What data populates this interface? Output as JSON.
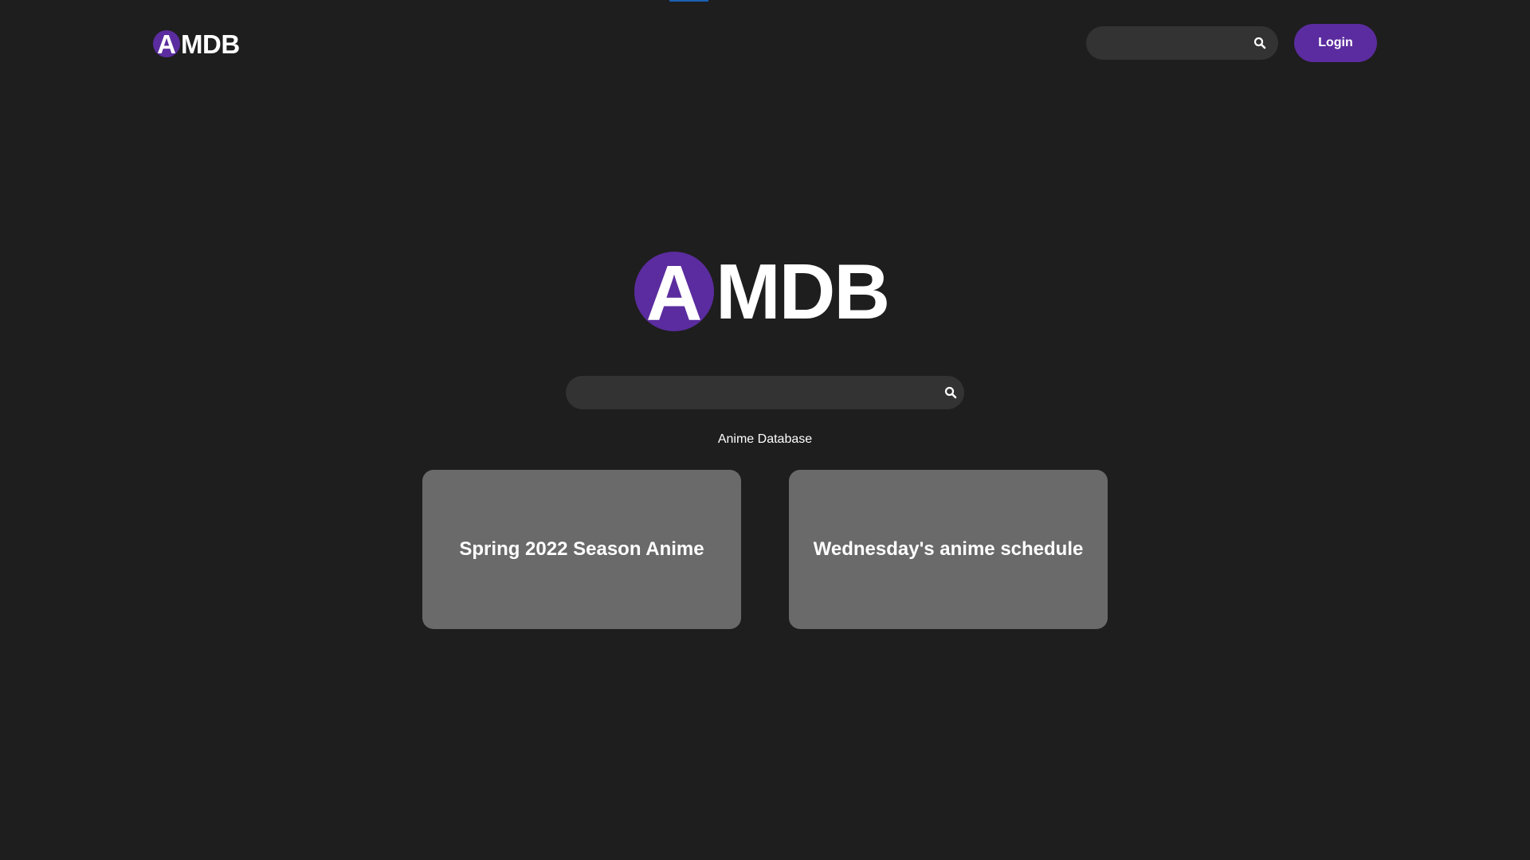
{
  "header": {
    "logo": {
      "letter": "A",
      "rest": "MDB"
    },
    "search": {
      "placeholder": "",
      "value": "",
      "icon": "search-icon"
    },
    "login_label": "Login"
  },
  "hero": {
    "logo": {
      "letter": "A",
      "rest": "MDB"
    },
    "search": {
      "placeholder": "",
      "value": "",
      "icon": "search-icon"
    },
    "subtitle": "Anime Database"
  },
  "cards": [
    {
      "label": "Spring 2022 Season Anime"
    },
    {
      "label": "Wednesday's anime schedule"
    }
  ],
  "colors": {
    "background": "#1e1e1e",
    "brand": "#5b2c9f",
    "input_bg": "#333333",
    "card_bg": "#6a6a6a",
    "accent_line": "#1a5fb4"
  }
}
